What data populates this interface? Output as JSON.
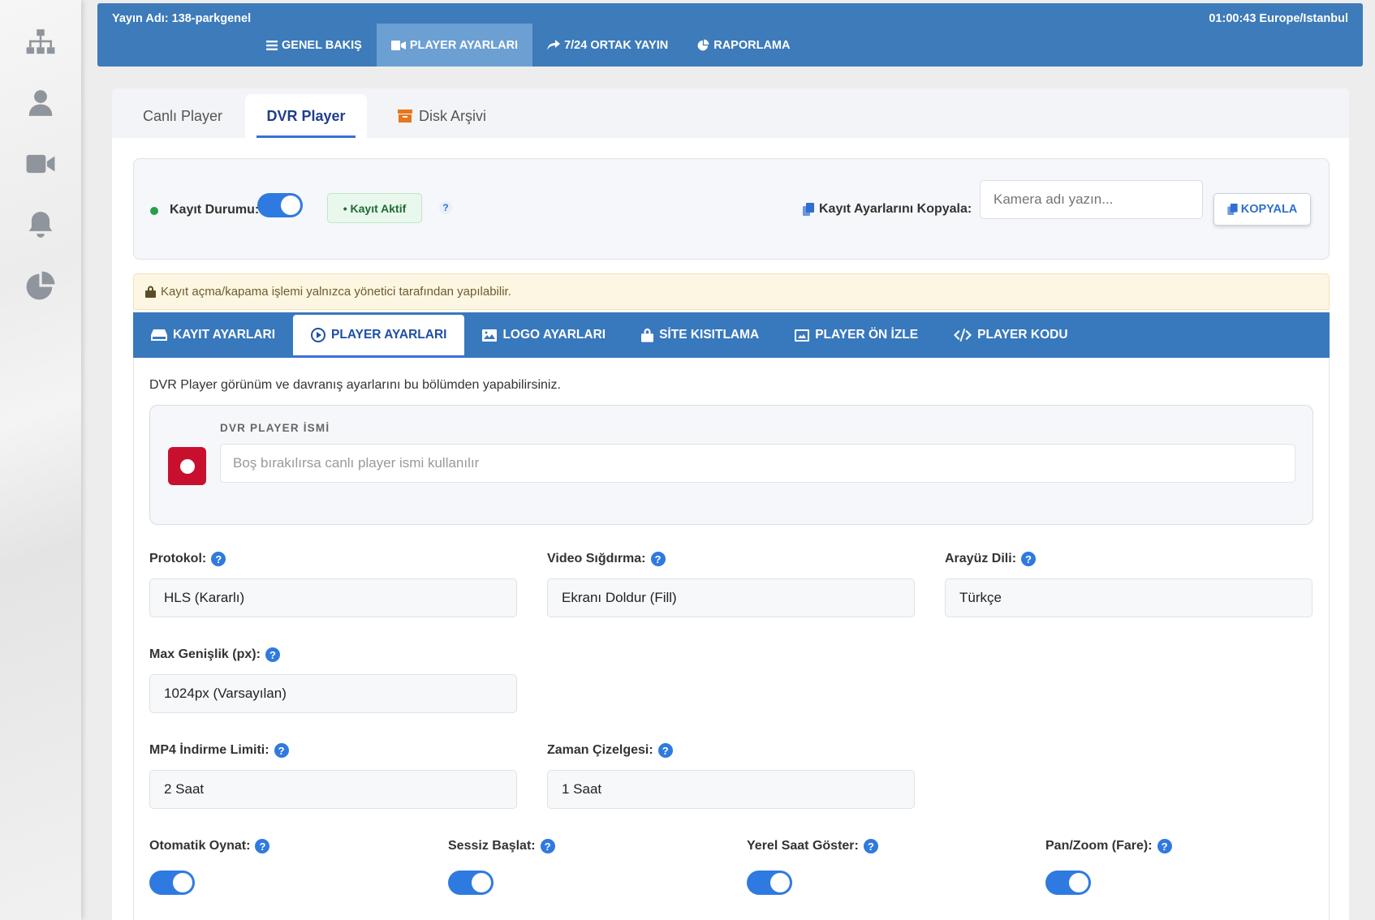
{
  "sidebar": {
    "icons": [
      "sitemap-icon",
      "user-icon",
      "video-camera-icon",
      "bell-icon",
      "pie-chart-icon"
    ]
  },
  "header": {
    "stream_name": "Yayın Adı: 138-parkgenel",
    "clock": "01:00:43 Europe/Istanbul",
    "nav": [
      {
        "label": "GENEL BAKIŞ",
        "icon": "list-icon"
      },
      {
        "label": "PLAYER AYARLARI",
        "icon": "video-icon",
        "active": true
      },
      {
        "label": "7/24 ORTAK YAYIN",
        "icon": "share-icon"
      },
      {
        "label": "RAPORLAMA",
        "icon": "pie-chart-icon"
      }
    ]
  },
  "tabs": [
    {
      "label": "Canlı Player"
    },
    {
      "label": "DVR Player",
      "active": true
    },
    {
      "label": "Disk Arşivi",
      "icon": "archive-icon"
    }
  ],
  "record": {
    "status_label": "Kayıt Durumu:",
    "status_on": true,
    "badge": "• Kayıt Aktif",
    "help": "?",
    "copy_label": "Kayıt Ayarlarını Kopyala:",
    "camera_placeholder": "Kamera adı yazın...",
    "copy_button": "KOPYALA"
  },
  "warning": "Kayıt açma/kapama işlemi yalnızca yönetici tarafından yapılabilir.",
  "subnav": [
    {
      "label": "KAYIT AYARLARI",
      "icon": "hdd-icon"
    },
    {
      "label": "PLAYER AYARLARI",
      "icon": "play-circle-icon",
      "active": true
    },
    {
      "label": "LOGO AYARLARI",
      "icon": "image-icon"
    },
    {
      "label": "SİTE KISITLAMA",
      "icon": "lock-icon"
    },
    {
      "label": "PLAYER ÖN İZLE",
      "icon": "preview-icon"
    },
    {
      "label": "PLAYER KODU",
      "icon": "code-icon"
    }
  ],
  "content": {
    "description": "DVR Player görünüm ve davranış ayarlarını bu bölümden yapabilirsiniz.",
    "name_label": "DVR PLAYER İSMİ",
    "name_placeholder": "Boş bırakılırsa canlı player ismi kullanılır",
    "fields": {
      "protocol": {
        "label": "Protokol:",
        "value": "HLS (Kararlı)"
      },
      "video_fit": {
        "label": "Video Sığdırma:",
        "value": "Ekranı Doldur (Fill)"
      },
      "ui_lang": {
        "label": "Arayüz Dili:",
        "value": "Türkçe"
      },
      "max_width": {
        "label": "Max Genişlik (px):",
        "value": "1024px (Varsayılan)"
      },
      "mp4_limit": {
        "label": "MP4 İndirme Limiti:",
        "value": "2 Saat"
      },
      "timeline": {
        "label": "Zaman Çizelgesi:",
        "value": "1 Saat"
      }
    },
    "toggles": {
      "autoplay": {
        "label": "Otomatik Oynat:",
        "on": true
      },
      "muted": {
        "label": "Sessiz Başlat:",
        "on": true
      },
      "local_time": {
        "label": "Yerel Saat Göster:",
        "on": true
      },
      "panzoom": {
        "label": "Pan/Zoom (Fare):",
        "on": true
      }
    }
  },
  "colors": {
    "primary": "#3d7bba",
    "accent": "#2f7ae0",
    "record_red": "#c8102e",
    "success": "#2a9d4c"
  }
}
